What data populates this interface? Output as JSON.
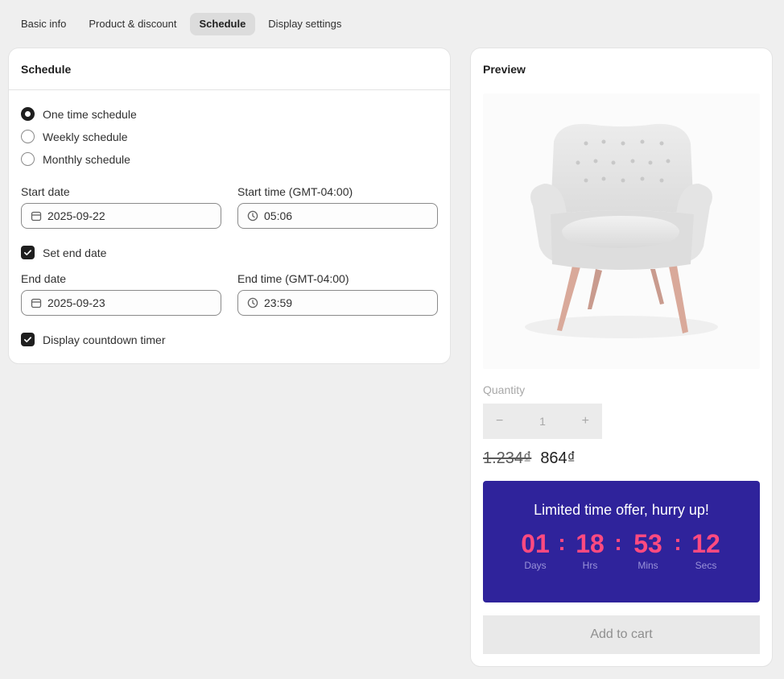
{
  "tabs": [
    {
      "label": "Basic info",
      "active": false
    },
    {
      "label": "Product & discount",
      "active": false
    },
    {
      "label": "Schedule",
      "active": true
    },
    {
      "label": "Display settings",
      "active": false
    }
  ],
  "schedule": {
    "title": "Schedule",
    "options": [
      {
        "label": "One time schedule",
        "selected": true
      },
      {
        "label": "Weekly schedule",
        "selected": false
      },
      {
        "label": "Monthly schedule",
        "selected": false
      }
    ],
    "start_date_label": "Start date",
    "start_date": "2025-09-22",
    "start_time_label": "Start time (GMT-04:00)",
    "start_time": "05:06",
    "set_end_date_label": "Set end date",
    "set_end_date_checked": true,
    "end_date_label": "End date",
    "end_date": "2025-09-23",
    "end_time_label": "End time (GMT-04:00)",
    "end_time": "23:59",
    "countdown_label": "Display countdown timer",
    "countdown_checked": true
  },
  "preview": {
    "title": "Preview",
    "quantity_label": "Quantity",
    "quantity": "1",
    "minus": "−",
    "plus": "+",
    "old_price": "1.234₫",
    "new_price": "864₫",
    "countdown": {
      "headline": "Limited time offer, hurry up!",
      "days": "01",
      "days_label": "Days",
      "hours": "18",
      "hours_label": "Hrs",
      "mins": "53",
      "mins_label": "Mins",
      "secs": "12",
      "secs_label": "Secs",
      "separator": ":",
      "background": "#2f239b",
      "number_color": "#ff4a80"
    },
    "add_to_cart": "Add to cart"
  },
  "icons": {
    "date": "calendar-icon",
    "time": "clock-icon",
    "check": "checkmark-icon"
  }
}
